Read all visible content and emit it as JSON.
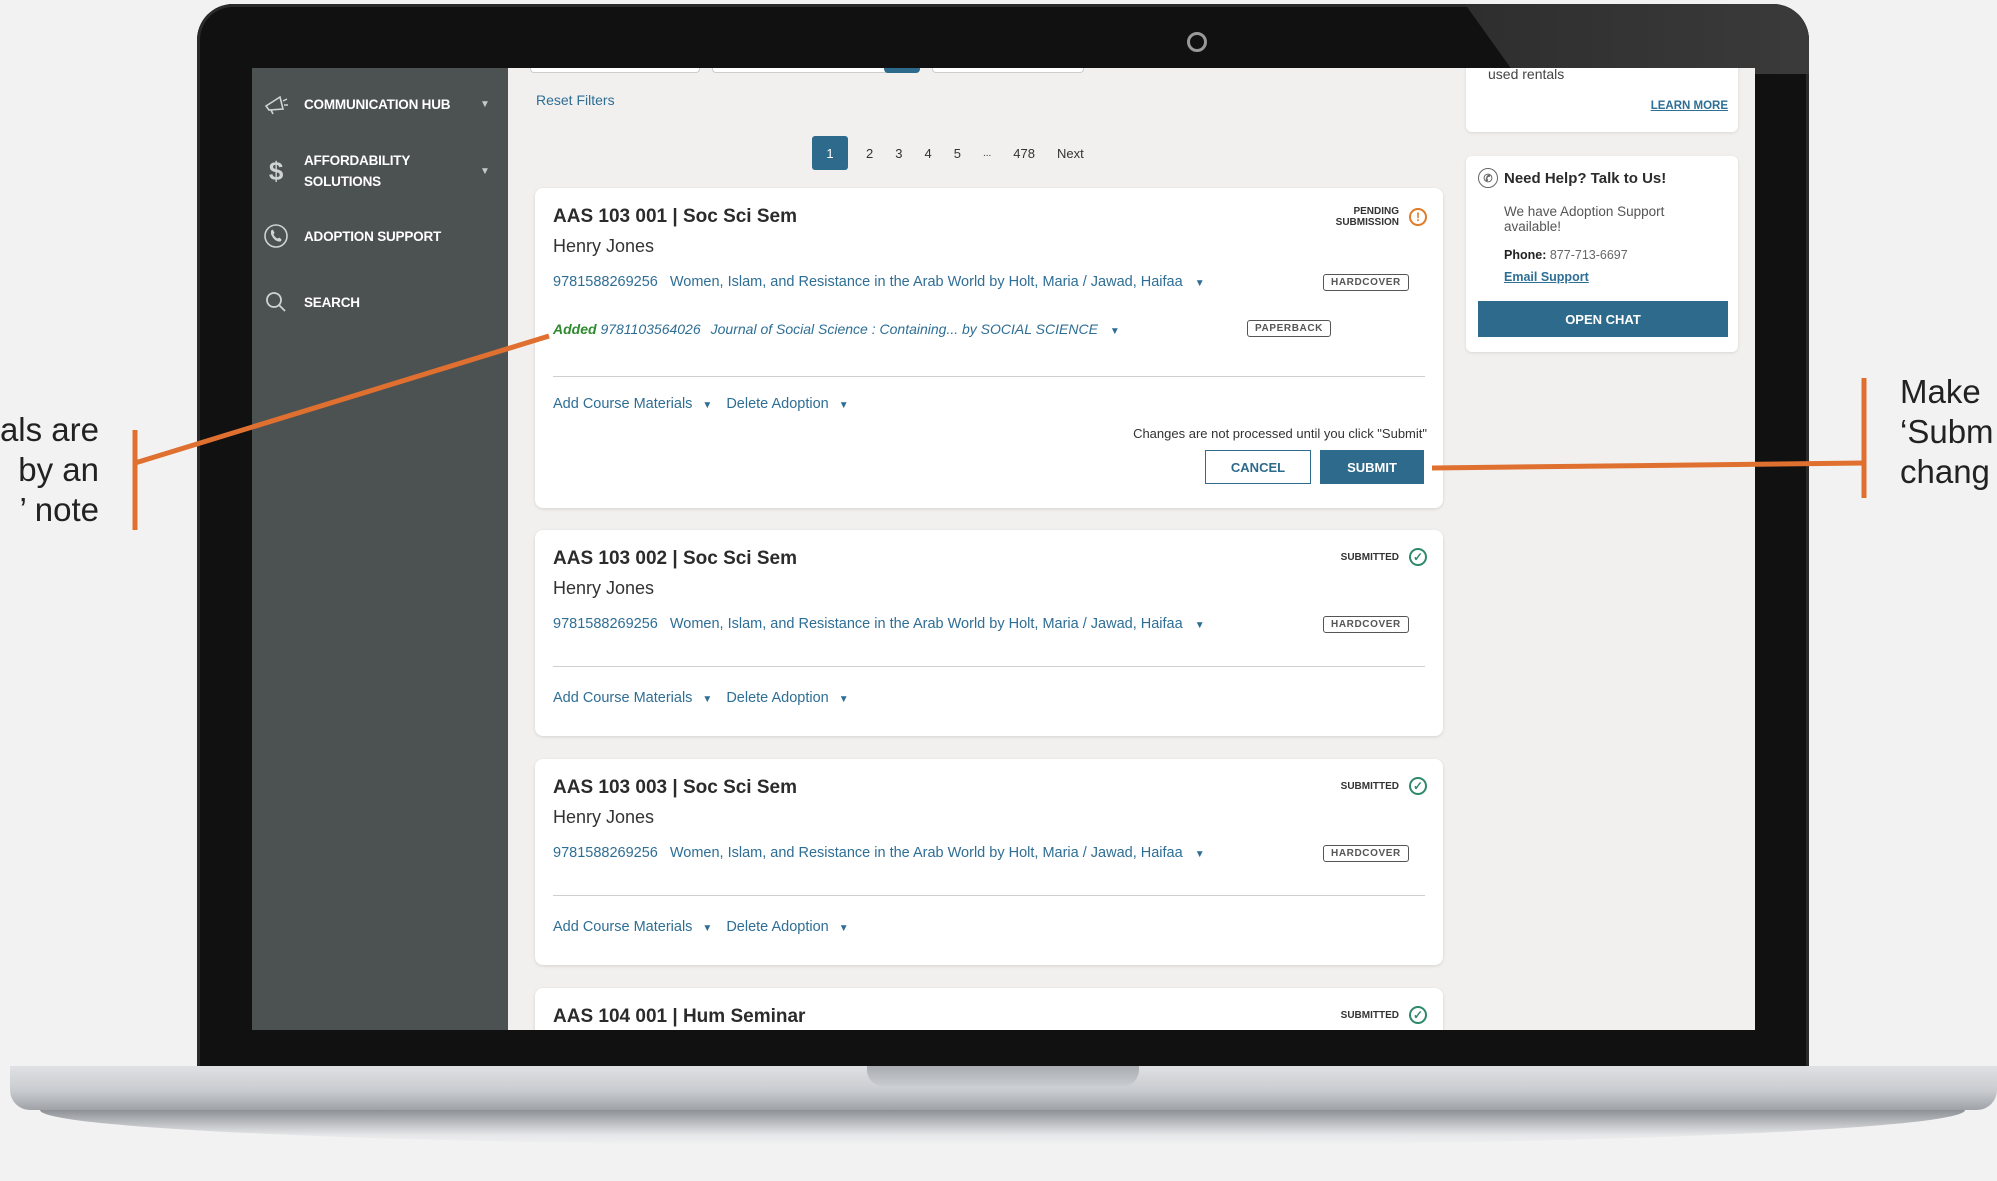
{
  "sidebar": {
    "items": [
      {
        "label": "COMMUNICATION HUB",
        "icon": "megaphone-icon",
        "caret": "▼"
      },
      {
        "label": "AFFORDABILITY",
        "label2": "SOLUTIONS",
        "icon": "dollar-icon",
        "caret": "▼"
      },
      {
        "label": "ADOPTION SUPPORT",
        "icon": "phone-icon"
      },
      {
        "label": "SEARCH",
        "icon": "search-icon"
      }
    ]
  },
  "filters": {
    "reset_label": "Reset Filters"
  },
  "pagination": {
    "pages": [
      "1",
      "2",
      "3",
      "4",
      "5",
      "...",
      "478"
    ],
    "current": "1",
    "next_label": "Next"
  },
  "courses": [
    {
      "title": "AAS 103 001  | Soc Sci Sem",
      "instructor": "Henry Jones",
      "status_line1": "PENDING",
      "status_line2": "SUBMISSION",
      "isbn": "9781588269256",
      "book": "Women, Islam, and Resistance in the Arab World by Holt, Maria / Jawad, Haifaa",
      "format": "HARDCOVER",
      "added_label": "Added",
      "added_isbn": "9781103564026",
      "added_book": "Journal of Social Science : Containing... by SOCIAL SCIENCE",
      "added_format": "PAPERBACK",
      "add_materials": "Add Course Materials",
      "delete_adoption": "Delete Adoption",
      "note": "Changes are not processed until you click \"Submit\"",
      "cancel_label": "CANCEL",
      "submit_label": "SUBMIT"
    },
    {
      "title": "AAS 103 002  | Soc Sci Sem",
      "instructor": "Henry Jones",
      "status": "SUBMITTED",
      "isbn": "9781588269256",
      "book": "Women, Islam, and Resistance in the Arab World by Holt, Maria / Jawad, Haifaa",
      "format": "HARDCOVER",
      "add_materials": "Add Course Materials",
      "delete_adoption": "Delete Adoption"
    },
    {
      "title": "AAS 103 003  | Soc Sci Sem",
      "instructor": "Henry Jones",
      "status": "SUBMITTED",
      "isbn": "9781588269256",
      "book": "Women, Islam, and Resistance in the Arab World by Holt, Maria / Jawad, Haifaa",
      "format": "HARDCOVER",
      "add_materials": "Add Course Materials",
      "delete_adoption": "Delete Adoption"
    },
    {
      "title": "AAS 104 001  | Hum Seminar",
      "status": "SUBMITTED"
    }
  ],
  "rentals_panel": {
    "text": "used rentals",
    "learn_more": "LEARN MORE"
  },
  "help_panel": {
    "title": "Need Help? Talk to Us!",
    "text": "We have Adoption Support available!",
    "phone_label": "Phone:",
    "phone": "877-713-6697",
    "email_label": "Email Support",
    "chat_label": "OPEN CHAT"
  },
  "callouts": {
    "left": [
      "als are",
      "by an",
      "’ note"
    ],
    "right": [
      "Make",
      "‘Subm",
      "chang"
    ]
  },
  "colors": {
    "accent": "#2d6a8b",
    "sidebar": "#4c5151",
    "added_green": "#2f8a2f",
    "pending_orange": "#e07b28",
    "callout_line": "#e07030"
  }
}
